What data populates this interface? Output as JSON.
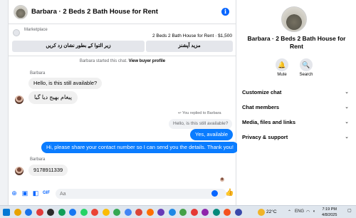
{
  "chat": {
    "title": "Barbara · 2 Beds 2 Bath House for Rent",
    "info_icon": "info-icon",
    "marketplace": {
      "label": "Marketplace",
      "listing": "2 Beds 2 Bath House for Rent · $1,500",
      "button_left": "زیر التوا کے بطور نشان زد کریں",
      "button_right": "مزید آپشنز"
    },
    "system_note_prefix": "Barbara started this chat.",
    "system_note_link": "View buyer profile",
    "messages": {
      "sender1": "Barbara",
      "m1": "Hello, is this still available?",
      "m2": "پیغام بھیج دیا گیا",
      "replied_label": "You replied to Barbara",
      "quoted": "Hello, is this still available?",
      "m3": "Yes, available",
      "m4": "Hi, please share your contact number so I can send you the details. Thank you!",
      "sender2": "Barbara",
      "m5": "9178911339"
    },
    "composer_placeholder": "Aa"
  },
  "side": {
    "title": "Barbara · 2 Beds 2 Bath House for Rent",
    "mute_label": "Mute",
    "search_label": "Search",
    "rows": [
      "Customize chat",
      "Chat members",
      "Media, files and links",
      "Privacy & support"
    ]
  },
  "taskbar": {
    "temperature": "22°C",
    "lang": "ENG",
    "time": "7:19 PM",
    "date": "4/8/2025",
    "colors": [
      "#0078d4",
      "#e8a200",
      "#1a73e8",
      "#e23b3b",
      "#2b2b2b",
      "#0f9d58",
      "#1877f2",
      "#25d366",
      "#ea4335",
      "#fbbc05",
      "#34a853",
      "#4285f4",
      "#db4437",
      "#ff6f00",
      "#673ab7",
      "#1e88e5",
      "#43a047",
      "#e53935",
      "#8e24aa",
      "#00897b",
      "#f4511e",
      "#3949ab"
    ]
  }
}
